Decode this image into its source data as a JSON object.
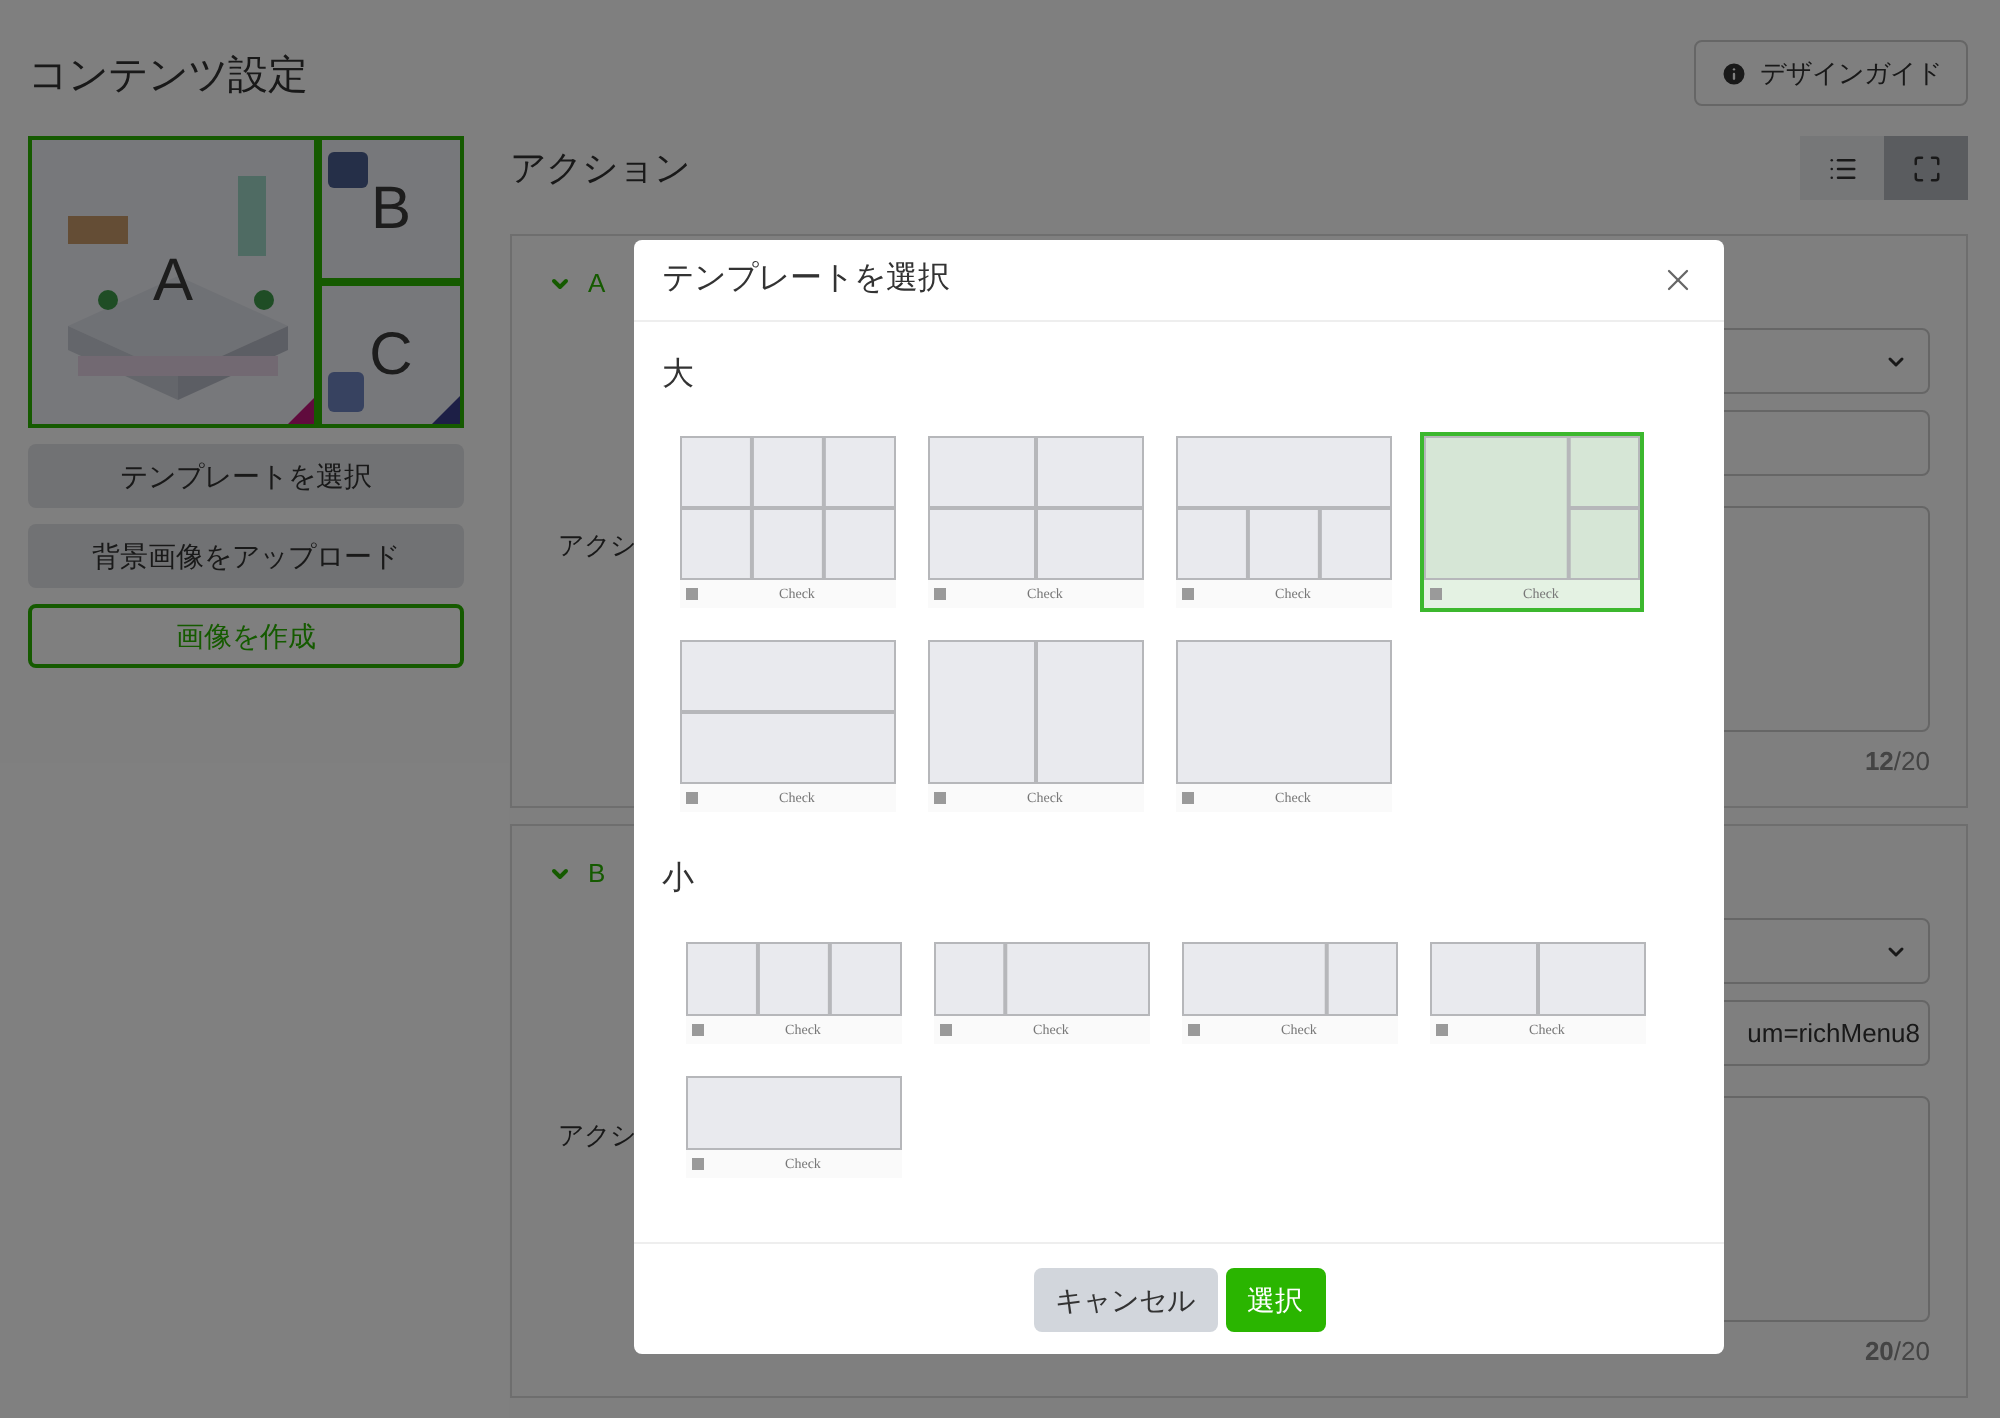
{
  "page": {
    "title": "コンテンツ設定",
    "design_guide_button": "デザインガイド"
  },
  "preview": {
    "areas": [
      {
        "label": "A"
      },
      {
        "label": "B"
      },
      {
        "label": "C"
      }
    ]
  },
  "left_buttons": [
    {
      "label": "テンプレートを選択",
      "kind": "secondary"
    },
    {
      "label": "背景画像をアップロード",
      "kind": "secondary"
    },
    {
      "label": "画像を作成",
      "kind": "outline"
    }
  ],
  "actions": {
    "title": "アクション",
    "view_toggle": [
      {
        "kind": "list",
        "selected": false
      },
      {
        "kind": "expand",
        "selected": true
      }
    ]
  },
  "cards": [
    {
      "label": "A",
      "expanded": true,
      "field_label": "アクシ",
      "counter": "**12**/20"
    },
    {
      "label": "B",
      "expanded": true,
      "field_label": "アクシ",
      "input_value": "um=richMenu8",
      "counter": "**20**/20"
    }
  ],
  "modal": {
    "title": "テンプレートを選択",
    "sections": [
      {
        "heading": "大",
        "templates": [
          {
            "kind": "grid6",
            "label": "Check",
            "selected": false
          },
          {
            "kind": "grid4",
            "label": "Check",
            "selected": false
          },
          {
            "kind": "top1bottom3",
            "label": "Check",
            "selected": false
          },
          {
            "kind": "left1right2",
            "label": "Check",
            "selected": true
          },
          {
            "kind": "rows2",
            "label": "Check",
            "selected": false
          },
          {
            "kind": "cols2",
            "label": "Check",
            "selected": false
          },
          {
            "kind": "single",
            "label": "Check",
            "selected": false
          }
        ]
      },
      {
        "heading": "小",
        "templates": [
          {
            "kind": "strip3",
            "label": "Check",
            "selected": false
          },
          {
            "kind": "stripleft",
            "label": "Check",
            "selected": false
          },
          {
            "kind": "stripright",
            "label": "Check",
            "selected": false
          },
          {
            "kind": "strip2",
            "label": "Check",
            "selected": false
          },
          {
            "kind": "strip1",
            "label": "Check",
            "selected": false
          }
        ]
      }
    ],
    "buttons": [
      {
        "label": "キャンセル",
        "kind": "cancel"
      },
      {
        "label": "選択",
        "kind": "primary"
      }
    ]
  }
}
